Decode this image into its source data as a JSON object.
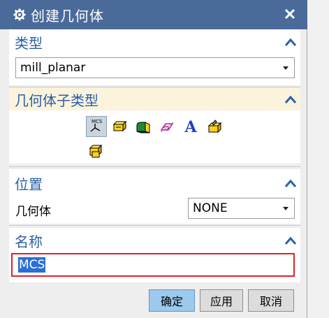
{
  "titlebar": {
    "title": "创建几何体",
    "icon": "gear-icon",
    "close_icon": "close-icon"
  },
  "type_section": {
    "label": "类型",
    "selected": "mill_planar"
  },
  "subtype_section": {
    "label": "几何体子类型"
  },
  "position_section": {
    "label": "位置",
    "field_label": "几何体",
    "selected": "NONE"
  },
  "name_section": {
    "label": "名称",
    "value": "MCS"
  },
  "buttons": {
    "ok": "确定",
    "apply": "应用",
    "cancel": "取消"
  },
  "icons": {
    "mcs_label": "MCS",
    "text_icon": "A"
  },
  "colors": {
    "titlebar": "#4a6a9a",
    "section_label": "#2a5fa8",
    "highlight_section": "#fbf3dc",
    "name_border": "#e0202a",
    "ok_button": "#9dc9ec"
  }
}
